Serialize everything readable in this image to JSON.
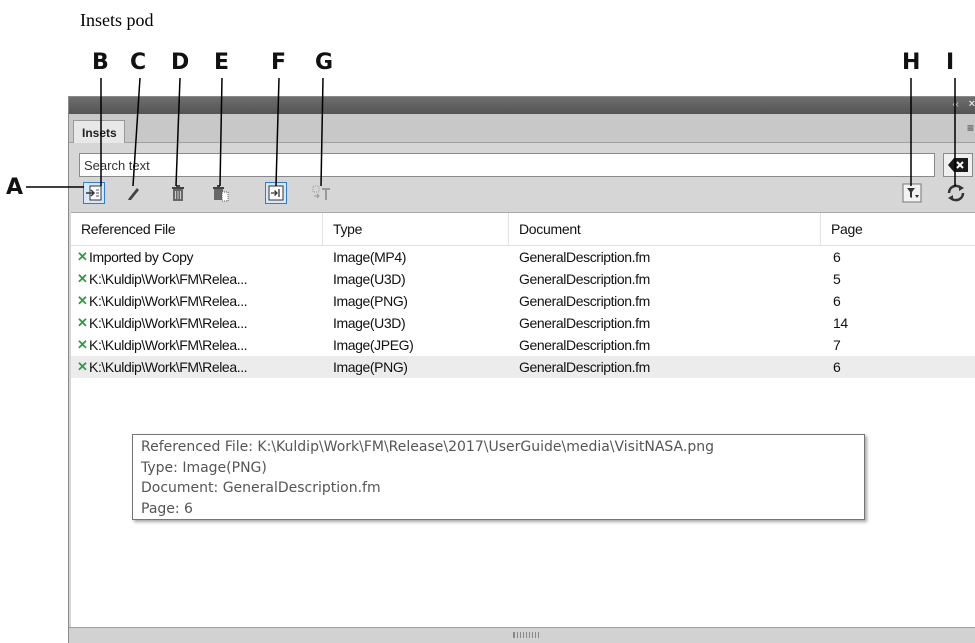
{
  "caption": "Insets pod",
  "callouts": {
    "a": "A",
    "b": "B",
    "c": "C",
    "d": "D",
    "e": "E",
    "f": "F",
    "g": "G",
    "h": "H",
    "i": "I"
  },
  "panel": {
    "tab_label": "Insets",
    "collapse_glyph": "‹‹",
    "close_glyph": "×",
    "menu_glyph": "≡",
    "search": {
      "value": "Search text",
      "placeholder": "Search text"
    },
    "toolbar": [
      {
        "name": "insert-inset-icon",
        "selected": true
      },
      {
        "name": "edit-icon",
        "selected": false
      },
      {
        "name": "delete-icon",
        "selected": false
      },
      {
        "name": "delete-all-icon",
        "selected": false
      },
      {
        "name": "go-to-inset-icon",
        "selected": true
      },
      {
        "name": "convert-to-text-icon",
        "selected": false
      },
      {
        "name": "filter-icon",
        "selected": false
      },
      {
        "name": "refresh-icon",
        "selected": false
      }
    ],
    "columns": [
      "Referenced File",
      "Type",
      "Document",
      "Page"
    ],
    "rows": [
      {
        "file": "Imported by Copy",
        "type": "Image(MP4)",
        "document": "GeneralDescription.fm",
        "page": "6"
      },
      {
        "file": "K:\\Kuldip\\Work\\FM\\Relea...",
        "type": "Image(U3D)",
        "document": "GeneralDescription.fm",
        "page": "5"
      },
      {
        "file": "K:\\Kuldip\\Work\\FM\\Relea...",
        "type": "Image(PNG)",
        "document": "GeneralDescription.fm",
        "page": "6"
      },
      {
        "file": "K:\\Kuldip\\Work\\FM\\Relea...",
        "type": "Image(U3D)",
        "document": "GeneralDescription.fm",
        "page": "14"
      },
      {
        "file": "K:\\Kuldip\\Work\\FM\\Relea...",
        "type": "Image(JPEG)",
        "document": "GeneralDescription.fm",
        "page": "7"
      },
      {
        "file": "K:\\Kuldip\\Work\\FM\\Relea...",
        "type": "Image(PNG)",
        "document": "GeneralDescription.fm",
        "page": "6"
      }
    ],
    "row_icon": "✕",
    "tooltip": {
      "line1": "Referenced File: K:\\Kuldip\\Work\\FM\\Release\\2017\\UserGuide\\media\\VisitNASA.png",
      "line2": "Type: Image(PNG)",
      "line3": "Document: GeneralDescription.fm",
      "line4": "Page: 6"
    },
    "colors": {
      "accent": "#2b7de1",
      "status_ok": "#2e9e3e",
      "titlebar": "#5e5e5e"
    }
  }
}
